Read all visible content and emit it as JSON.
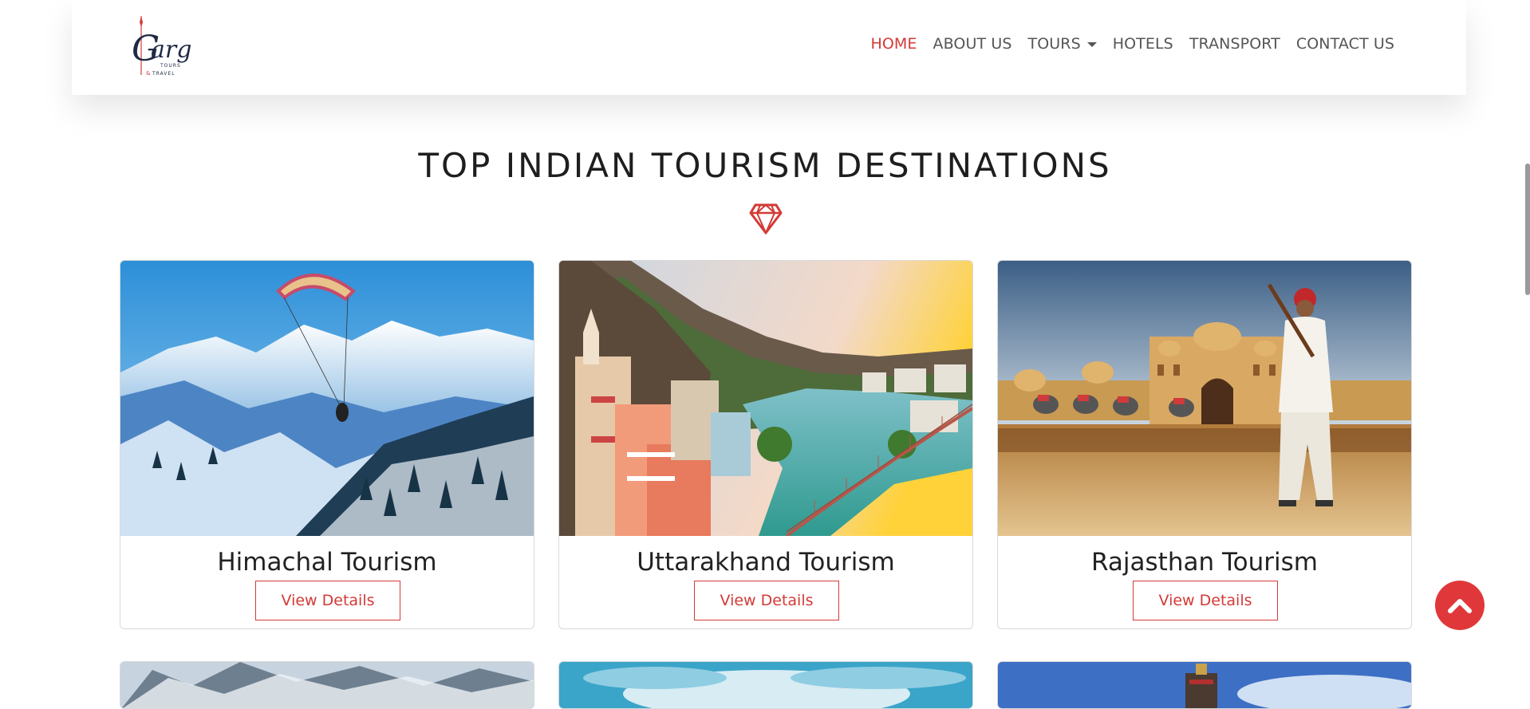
{
  "header": {
    "logo": {
      "text": "Garg",
      "sub1": "TOURS",
      "sub2": "& TRAVEL"
    },
    "nav": [
      {
        "label": "HOME",
        "active": true
      },
      {
        "label": "ABOUT US",
        "active": false
      },
      {
        "label": "TOURS",
        "active": false,
        "dropdown": true
      },
      {
        "label": "HOTELS",
        "active": false
      },
      {
        "label": "TRANSPORT",
        "active": false
      },
      {
        "label": "CONTACT US",
        "active": false
      }
    ]
  },
  "section": {
    "title": "TOP INDIAN TOURISM DESTINATIONS",
    "icon": "diamond-icon"
  },
  "cards": [
    {
      "title": "Himachal Tourism",
      "button": "View Details",
      "image": "mountain-paraglider-photo"
    },
    {
      "title": "Uttarakhand Tourism",
      "button": "View Details",
      "image": "river-town-bridge-photo"
    },
    {
      "title": "Rajasthan Tourism",
      "button": "View Details",
      "image": "palace-musician-photo"
    }
  ],
  "colors": {
    "accent": "#d33a36",
    "nav_text": "#555555",
    "heading": "#1e1e1e"
  },
  "back_to_top": {
    "icon": "chevron-up-icon"
  }
}
